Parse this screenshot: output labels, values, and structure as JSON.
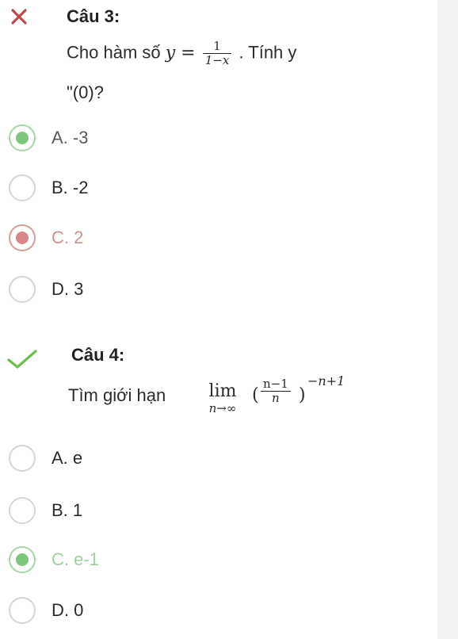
{
  "q3": {
    "title": "Câu 3:",
    "status": "wrong",
    "text_prefix": "Cho hàm số",
    "math_lhs": "y =",
    "frac_num": "1",
    "frac_den": "1−x",
    "text_suffix": ". Tính y",
    "text_line2": "\"(0)?",
    "options": [
      {
        "label": "A. -3",
        "state": "correct"
      },
      {
        "label": "B. -2",
        "state": "none"
      },
      {
        "label": "C. 2",
        "state": "wrong"
      },
      {
        "label": "D. 3",
        "state": "none"
      }
    ]
  },
  "q4": {
    "title": "Câu 4:",
    "status": "correct",
    "text_prefix": "Tìm giới hạn",
    "lim": "lim",
    "lim_sub": "n→∞",
    "paren_open": "(",
    "frac_num": "n−1",
    "frac_den": "n",
    "paren_close": ")",
    "exponent": "−n+1",
    "options": [
      {
        "label": "A. e",
        "state": "none"
      },
      {
        "label": "B. 1",
        "state": "none"
      },
      {
        "label": "C. e-1",
        "state": "correct"
      },
      {
        "label": "D. 0",
        "state": "none"
      }
    ]
  },
  "colors": {
    "correct": "#7fc47f",
    "wrong": "#b84a4a",
    "check": "#6cbf4a"
  }
}
